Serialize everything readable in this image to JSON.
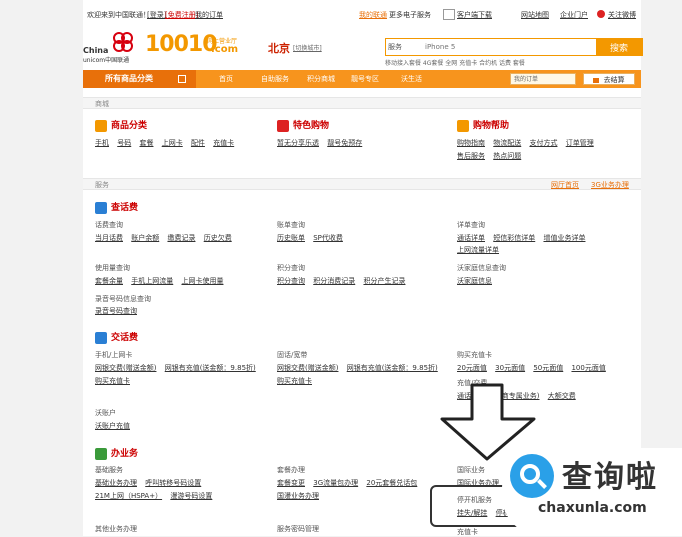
{
  "topbar": {
    "welcome": "欢迎来到中国联通！",
    "login": "[登录]",
    "register": "[免费注册]",
    "my_order": "我的订单",
    "my_unicom": "我的联通",
    "more_services": "更多电子服务",
    "client_download": "客户端下载",
    "sitemap": "网站地图",
    "enterprise": "企业门户",
    "follow_weibo": "关注微博"
  },
  "header": {
    "logo_text_1": "China",
    "logo_text_2": "unicom中国联通",
    "hotline": "10010",
    "hotline_sub": "网上营业厅",
    "hotline_dotcom": ".com",
    "city": "北京",
    "city_switch": "[切换城市]",
    "search": {
      "type": "服务",
      "placeholder": "iPhone 5",
      "button": "搜索",
      "hot_words": "移动接入套餐 4G套餐 全网 充值卡 合约机 话费 套餐"
    }
  },
  "nav": {
    "all_categories": "所有商品分类",
    "items": [
      "首页",
      "自助服务",
      "积分商城",
      "靓号专区",
      "沃生活"
    ],
    "my_order": "我的订单",
    "cart": "去结算"
  },
  "mall": {
    "section_label": "商城",
    "columns": [
      {
        "title": "商品分类",
        "links": [
          "手机",
          "号码",
          "套餐",
          "上网卡",
          "配件",
          "充值卡"
        ]
      },
      {
        "title": "特色购物",
        "links": [
          "暂无分享乐透",
          "靓号免预存"
        ]
      },
      {
        "title": "购物帮助",
        "links": [
          "购物指南",
          "物流配送",
          "支付方式",
          "订单管理",
          "售后服务",
          "热点问题"
        ]
      }
    ]
  },
  "services": {
    "section_label": "服务",
    "right_links": [
      "网厅首页",
      "3G业务办理"
    ],
    "query": {
      "title": "查话费",
      "groups": [
        {
          "label": "话费查询",
          "links": [
            "当月话费",
            "账户余额",
            "缴费记录",
            "历史欠费"
          ]
        },
        {
          "label": "账单查询",
          "links": [
            "历史账单",
            "SP代收费"
          ]
        },
        {
          "label": "详单查询",
          "links": [
            "通话详单",
            "短信彩信详单",
            "增值业务详单",
            "上网流量详单"
          ]
        },
        {
          "label": "使用量查询",
          "links": [
            "套餐余量",
            "手机上网流量",
            "上网卡使用量"
          ]
        },
        {
          "label": "积分查询",
          "links": [
            "积分查询",
            "积分消费记录",
            "积分产生记录"
          ]
        },
        {
          "label": "沃家庭信息查询",
          "links": [
            "沃家庭信息"
          ]
        },
        {
          "label": "录音号码信息查询",
          "links": [
            "录音号码查询"
          ]
        }
      ]
    },
    "pay": {
      "title": "交话费",
      "groups": [
        {
          "label": "手机/上网卡",
          "links": [
            "网银交费(赠送金额)",
            "网银有充值(送金额：9.85折)",
            "购买充值卡"
          ]
        },
        {
          "label": "固话/宽带",
          "links": [
            "网银交费(赠送金额)",
            "网银有充值(送金额：9.85折)",
            "购买充值卡"
          ]
        },
        {
          "label": "购买充值卡",
          "links": [
            "20元面值",
            "30元面值",
            "50元面值",
            "100元面值"
          ]
        },
        {
          "label": "充值/交费",
          "links": [
            "通话交费(代理商专属业务)",
            "大额交费"
          ]
        },
        {
          "label": "沃账户",
          "links": [
            "沃账户充值"
          ]
        }
      ]
    },
    "business": {
      "title": "办业务",
      "groups": [
        {
          "label": "基础服务",
          "links": [
            "基础业务办理",
            "呼叫转移号码设置",
            "21M上网（HSPA+）",
            "漫游号码设置"
          ]
        },
        {
          "label": "套餐办理",
          "links": [
            "套餐变更",
            "3G流量包办理",
            "20元套餐兑话包",
            "国漫业务办理"
          ]
        },
        {
          "label": "国际业务",
          "links": [
            "国际业务办理"
          ]
        },
        {
          "label": "停开机服务",
          "links": [
            "挂失/解挂",
            "停机保号"
          ]
        },
        {
          "label": "其他业务办理",
          "links": []
        },
        {
          "label": "服务密码管理",
          "links": []
        },
        {
          "label": "充值卡",
          "links": []
        }
      ]
    }
  },
  "watermark": {
    "text": "查询啦",
    "url": "chaxunla.com"
  }
}
